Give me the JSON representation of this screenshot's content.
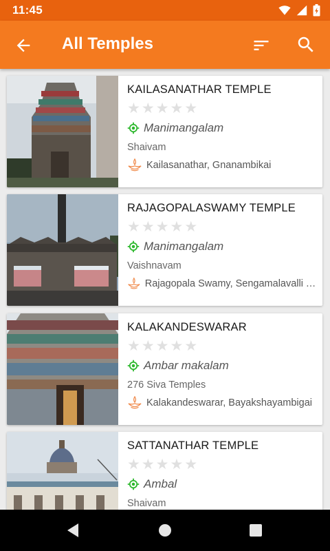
{
  "status": {
    "time": "11:45"
  },
  "app_bar": {
    "title": "All Temples"
  },
  "temples": [
    {
      "name": "KAILASANATHAR TEMPLE",
      "rating": 0,
      "location": "Manimangalam",
      "sect": "Shaivam",
      "deities": "Kailasanathar, Gnanambikai"
    },
    {
      "name": "RAJAGOPALASWAMY TEMPLE",
      "rating": 0,
      "location": "Manimangalam",
      "sect": "Vaishnavam",
      "deities": "Rajagopala Swamy, Sengamalavalli Thayar"
    },
    {
      "name": "KALAKANDESWARAR",
      "rating": 0,
      "location": "Ambar makalam",
      "sect": "276 Siva Temples",
      "deities": "Kalakandeswarar, Bayakshayambigai"
    },
    {
      "name": "SATTANATHAR TEMPLE",
      "rating": 0,
      "location": "Ambal",
      "sect": "Shaivam",
      "deities": ""
    }
  ],
  "colors": {
    "status_bar": "#e8620e",
    "app_bar": "#f47a1f",
    "location_icon": "#2db82d",
    "lamp_icon": "#f08a4b",
    "star_empty": "#e0e0e0"
  },
  "icons": {
    "back": "arrow-left-icon",
    "sort": "sort-icon",
    "search": "search-icon",
    "location": "gps-target-icon",
    "deity": "oil-lamp-icon",
    "rating": "star-icon"
  }
}
